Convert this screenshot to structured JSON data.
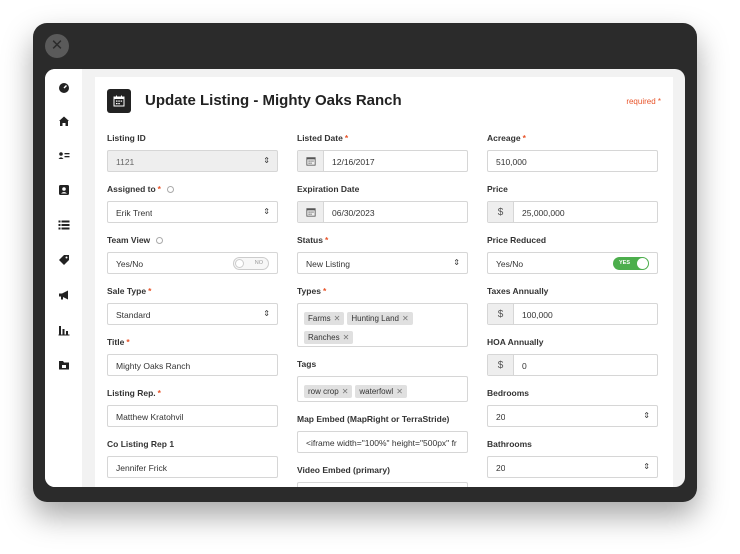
{
  "window": {
    "close_glyph": "✕"
  },
  "sidebar": {
    "icons": [
      "dashboard-icon",
      "home-icon",
      "contacts-icon",
      "profile-icon",
      "list-icon",
      "tag-icon",
      "megaphone-icon",
      "chart-icon",
      "folder-icon"
    ]
  },
  "header": {
    "title": "Update Listing - Mighty Oaks Ranch",
    "required_note": "required *"
  },
  "form": {
    "listing_id": {
      "label": "Listing ID",
      "value": "1121"
    },
    "assigned_to": {
      "label": "Assigned to",
      "value": "Erik Trent"
    },
    "team_view": {
      "label": "Team View",
      "value": "Yes/No",
      "toggle": "NO"
    },
    "sale_type": {
      "label": "Sale Type",
      "value": "Standard"
    },
    "title": {
      "label": "Title",
      "value": "Mighty Oaks Ranch"
    },
    "listing_rep": {
      "label": "Listing Rep.",
      "value": "Matthew Kratohvil"
    },
    "co_listing_rep": {
      "label": "Co Listing Rep 1",
      "value": "Jennifer Frick"
    },
    "listed_date": {
      "label": "Listed Date",
      "value": "12/16/2017"
    },
    "expiration_date": {
      "label": "Expiration Date",
      "value": "06/30/2023"
    },
    "status": {
      "label": "Status",
      "value": "New Listing"
    },
    "types": {
      "label": "Types",
      "chips": [
        "Farms",
        "Hunting Land",
        "Ranches"
      ]
    },
    "tags": {
      "label": "Tags",
      "chips": [
        "row crop",
        "waterfowl"
      ]
    },
    "map_embed": {
      "label": "Map Embed (MapRight or TerraStride)",
      "value": "<iframe width=\"100%\" height=\"500px\" fr"
    },
    "video_embed": {
      "label": "Video Embed (primary)"
    },
    "acreage": {
      "label": "Acreage",
      "value": "510,000"
    },
    "price": {
      "label": "Price",
      "value": "25,000,000",
      "prefix": "$"
    },
    "price_reduced": {
      "label": "Price Reduced",
      "value": "Yes/No",
      "toggle": "YES"
    },
    "taxes_annually": {
      "label": "Taxes Annually",
      "value": "100,000",
      "prefix": "$"
    },
    "hoa_annually": {
      "label": "HOA Annually",
      "value": "0",
      "prefix": "$"
    },
    "bedrooms": {
      "label": "Bedrooms",
      "value": "20"
    },
    "bathrooms": {
      "label": "Bathrooms",
      "value": "20"
    }
  },
  "colors": {
    "accent": "#e8542a",
    "toggle_on": "#4cae4c",
    "frame": "#2b2b2b"
  }
}
